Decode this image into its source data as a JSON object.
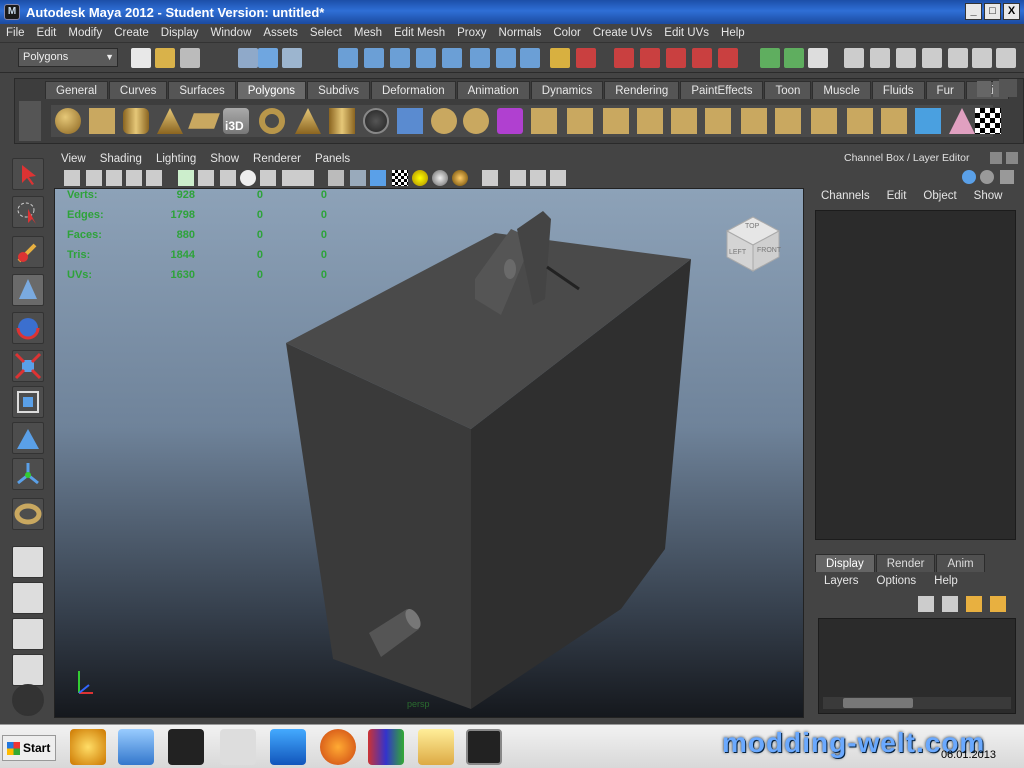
{
  "window": {
    "title": "Autodesk Maya 2012 - Student Version: untitled*",
    "app_icon": "maya-icon",
    "buttons": [
      "_",
      "□",
      "X"
    ]
  },
  "menubar": [
    "File",
    "Edit",
    "Modify",
    "Create",
    "Display",
    "Window",
    "Assets",
    "Select",
    "Mesh",
    "Edit Mesh",
    "Proxy",
    "Normals",
    "Color",
    "Create UVs",
    "Edit UVs",
    "Help"
  ],
  "statusline": {
    "menuset": "Polygons"
  },
  "shelf": {
    "tabs": [
      "General",
      "Curves",
      "Surfaces",
      "Polygons",
      "Subdivs",
      "Deformation",
      "Animation",
      "Dynamics",
      "Rendering",
      "PaintEffects",
      "Toon",
      "Muscle",
      "Fluids",
      "Fur",
      "Hair"
    ],
    "active_tab": "Polygons",
    "badge": "i3D"
  },
  "panel": {
    "menus": [
      "View",
      "Shading",
      "Lighting",
      "Show",
      "Renderer",
      "Panels"
    ]
  },
  "hud": {
    "rows": [
      {
        "label": "Verts:",
        "v1": "928",
        "v2": "0",
        "v3": "0"
      },
      {
        "label": "Edges:",
        "v1": "1798",
        "v2": "0",
        "v3": "0"
      },
      {
        "label": "Faces:",
        "v1": "880",
        "v2": "0",
        "v3": "0"
      },
      {
        "label": "Tris:",
        "v1": "1844",
        "v2": "0",
        "v3": "0"
      },
      {
        "label": "UVs:",
        "v1": "1630",
        "v2": "0",
        "v3": "0"
      }
    ],
    "camera": "persp",
    "viewcube": {
      "top": "TOP",
      "left": "LEFT",
      "front": "FRONT"
    }
  },
  "channel_box": {
    "title": "Channel Box / Layer Editor",
    "menus": [
      "Channels",
      "Edit",
      "Object",
      "Show"
    ]
  },
  "layer_editor": {
    "tabs": [
      "Display",
      "Render",
      "Anim"
    ],
    "active_tab": "Display",
    "menus": [
      "Layers",
      "Options",
      "Help"
    ]
  },
  "taskbar": {
    "start": "Start",
    "watermark": "modding-welt.com",
    "date": "06.01.2013"
  }
}
